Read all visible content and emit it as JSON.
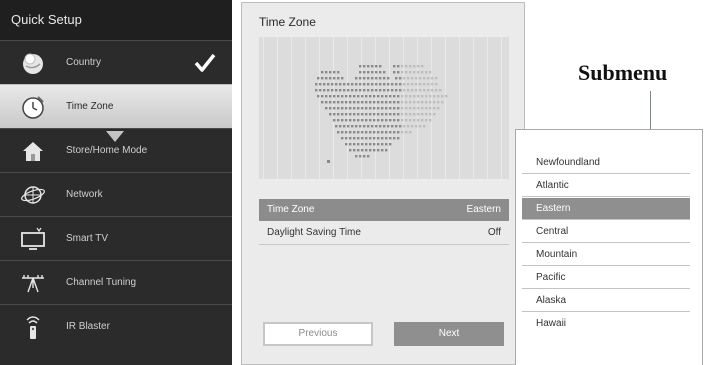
{
  "sidebar": {
    "title": "Quick Setup",
    "items": [
      {
        "label": "Country",
        "icon": "globe-disc-icon",
        "completed": true
      },
      {
        "label": "Time Zone",
        "icon": "clock-globe-icon",
        "active": true
      },
      {
        "label": "Store/Home Mode",
        "icon": "house-icon"
      },
      {
        "label": "Network",
        "icon": "network-globe-icon"
      },
      {
        "label": "Smart TV",
        "icon": "smart-tv-icon"
      },
      {
        "label": "Channel Tuning",
        "icon": "antenna-icon"
      },
      {
        "label": "IR Blaster",
        "icon": "ir-remote-icon"
      }
    ]
  },
  "panel": {
    "title": "Time Zone",
    "settings": [
      {
        "label": "Time Zone",
        "value": "Eastern",
        "selected": true
      },
      {
        "label": "Daylight Saving Time",
        "value": "Off"
      }
    ],
    "previous_label": "Previous",
    "next_label": "Next"
  },
  "callout": {
    "label": "Submenu"
  },
  "submenu": {
    "items": [
      "Newfoundland",
      "Atlantic",
      "Eastern",
      "Central",
      "Mountain",
      "Pacific",
      "Alaska",
      "Hawaii"
    ],
    "selected": "Eastern"
  },
  "colors": {
    "sidebar_bg": "#2b2b2b",
    "active_item_bg": "#d9d9d9",
    "selection_bg": "#8f8f8f",
    "panel_bg": "#ebebeb",
    "map_dots_light": "#bdbdbd",
    "map_dots_dark": "#8a8a8a"
  }
}
